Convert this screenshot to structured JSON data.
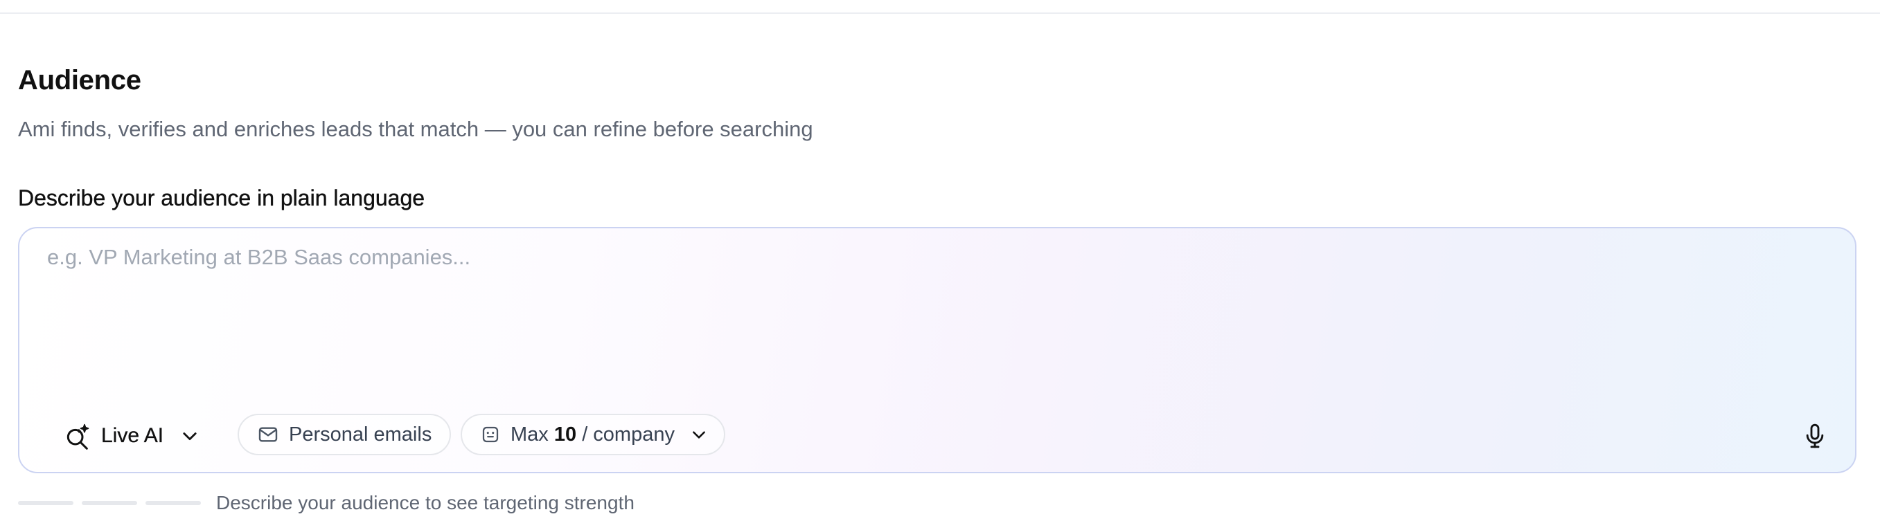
{
  "section": {
    "title": "Audience",
    "subtitle": "Ami finds, verifies and enriches leads that match — you can refine before searching"
  },
  "audience_input": {
    "label": "Describe your audience in plain language",
    "placeholder": "e.g. VP Marketing at B2B Saas companies...",
    "value": ""
  },
  "toolbar": {
    "mode": {
      "label": "Live AI",
      "icon": "search-sparkle-icon"
    },
    "email_filter": {
      "label": "Personal emails",
      "icon": "mail-icon"
    },
    "max_per_company": {
      "prefix": "Max",
      "value": "10",
      "suffix": "/ company",
      "icon": "counter-icon"
    },
    "mic": {
      "icon": "microphone-icon"
    }
  },
  "targeting_strength": {
    "segments_total": 3,
    "segments_filled": 0,
    "message": "Describe your audience to see targeting strength"
  },
  "colors": {
    "composer_border": "#cbd3f2",
    "muted_text": "#5f6673",
    "placeholder": "#a1a8b3",
    "segment_empty": "#e6e8ec"
  }
}
